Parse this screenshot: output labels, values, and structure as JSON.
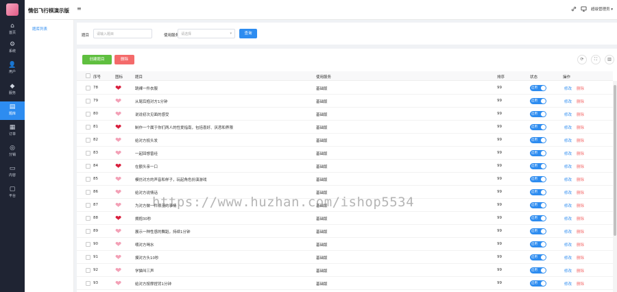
{
  "app": {
    "title": "情侣飞行棋演示版",
    "menu_toggle_glyph": "≡"
  },
  "rail": [
    {
      "icon": "home-icon",
      "glyph": "⌂",
      "label": "首页",
      "active": false
    },
    {
      "icon": "gear-icon",
      "glyph": "⚙",
      "label": "系统",
      "active": false
    },
    {
      "icon": "user-icon",
      "glyph": "👤",
      "label": "用户",
      "active": false
    },
    {
      "icon": "diamond-icon",
      "glyph": "◆",
      "label": "服务",
      "active": false
    },
    {
      "icon": "document-icon",
      "glyph": "▤",
      "label": "题库",
      "active": true
    },
    {
      "icon": "order-icon",
      "glyph": "▦",
      "label": "订单",
      "active": false
    },
    {
      "icon": "distribution-icon",
      "glyph": "◎",
      "label": "分销",
      "active": false
    },
    {
      "icon": "folder-icon",
      "glyph": "▭",
      "label": "内容",
      "active": false
    },
    {
      "icon": "monitor-icon",
      "glyph": "▢",
      "label": "平台",
      "active": false
    }
  ],
  "topbar": {
    "user": "超级管理员",
    "link_icon_glyph": "🔗",
    "screen_icon_glyph": "▭",
    "caret": "▾"
  },
  "subnav": {
    "item": "题库列表"
  },
  "filter": {
    "question_label": "题目",
    "question_placeholder": "请输入题目",
    "service_label": "使用服务",
    "service_placeholder": "请选择",
    "service_caret": "▾",
    "query_button": "查询"
  },
  "toolbar": {
    "create_button": "创建题目",
    "delete_button": "删除",
    "refresh_glyph": "⟳",
    "fullscreen_glyph": "⛶",
    "columns_glyph": "▥"
  },
  "table": {
    "headers": {
      "no": "序号",
      "icon": "图标",
      "question": "题目",
      "service": "使用服务",
      "sort": "排序",
      "status": "状态",
      "actions": "操作"
    },
    "edit_label": "修改",
    "delete_label": "删除",
    "status_on": "启用",
    "heart_colors": {
      "dark": "#d81e3c",
      "light": "#f3a0b6"
    },
    "rows": [
      {
        "no": "78",
        "question": "跳裸一件衣服",
        "service": "基础版",
        "sort": "99",
        "heart": "dark"
      },
      {
        "no": "79",
        "question": "从尾后抱对方1分钟",
        "service": "基础版",
        "sort": "99",
        "heart": "light"
      },
      {
        "no": "80",
        "question": "说说初次见面的感受",
        "service": "基础版",
        "sort": "99",
        "heart": "light"
      },
      {
        "no": "81",
        "question": "制作一个属于你们两人的性爱指南，包括喜好、厌恶和界限",
        "service": "基础版",
        "sort": "99",
        "heart": "dark"
      },
      {
        "no": "82",
        "question": "给对方抵头发",
        "service": "基础版",
        "sort": "99",
        "heart": "light"
      },
      {
        "no": "83",
        "question": "一起回想曾经",
        "service": "基础版",
        "sort": "99",
        "heart": "light"
      },
      {
        "no": "84",
        "question": "在额头亲一口",
        "service": "基础版",
        "sort": "99",
        "heart": "dark"
      },
      {
        "no": "85",
        "question": "模仿对方的声音和样子，玩起角色扮演游戏",
        "service": "基础版",
        "sort": "99",
        "heart": "light"
      },
      {
        "no": "86",
        "question": "给对方说情话",
        "service": "基础版",
        "sort": "99",
        "heart": "light"
      },
      {
        "no": "87",
        "question": "为对方做一件浪漫的事情",
        "service": "基础版",
        "sort": "99",
        "heart": "light"
      },
      {
        "no": "88",
        "question": "拥抱30秒",
        "service": "基础版",
        "sort": "99",
        "heart": "dark"
      },
      {
        "no": "89",
        "question": "展示一种性感的舞蹈，持续1分钟",
        "service": "基础版",
        "sort": "99",
        "heart": "light"
      },
      {
        "no": "90",
        "question": "喂对方喝水",
        "service": "基础版",
        "sort": "99",
        "heart": "light"
      },
      {
        "no": "91",
        "question": "摸对方头10秒",
        "service": "基础版",
        "sort": "99",
        "heart": "light"
      },
      {
        "no": "92",
        "question": "学猫叫三声",
        "service": "基础版",
        "sort": "99",
        "heart": "light"
      },
      {
        "no": "93",
        "question": "给对方按摩捏背1分钟",
        "service": "基础版",
        "sort": "99",
        "heart": "light"
      }
    ]
  },
  "watermark": "https://www.huzhan.com/ishop5534"
}
